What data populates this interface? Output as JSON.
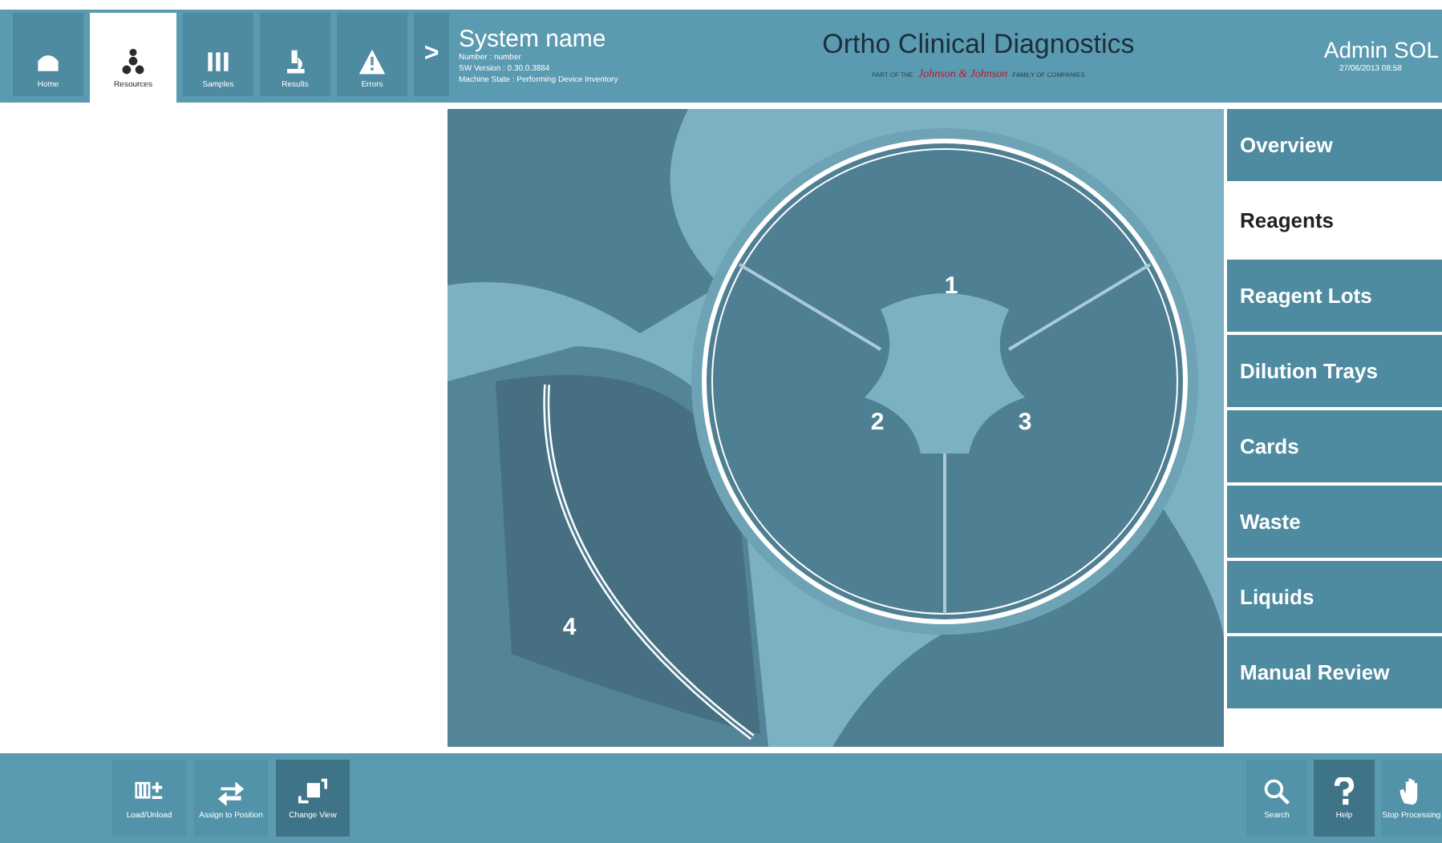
{
  "nav_tabs": [
    {
      "label": "Home",
      "kind": "home",
      "selected": false
    },
    {
      "label": "Resources",
      "kind": "resources",
      "selected": true
    },
    {
      "label": "Samples",
      "kind": "samples",
      "selected": false
    },
    {
      "label": "Results",
      "kind": "results",
      "selected": false
    },
    {
      "label": "Errors",
      "kind": "errors",
      "selected": false
    }
  ],
  "nav_more": ">",
  "system": {
    "name": "System name",
    "lines": [
      "Number : number",
      "SW Version : 0.30.0.3884",
      "Machine State : Performing Device Inventory"
    ]
  },
  "logo": {
    "title": "Ortho Clinical Diagnostics",
    "left": "PART OF THE",
    "brand": "Johnson & Johnson",
    "right": "FAMILY OF COMPANIES"
  },
  "user": {
    "name": "Admin SOL",
    "datetime": "27/06/2013 08:58"
  },
  "carousel": {
    "segments": [
      "1",
      "2",
      "3"
    ],
    "tray": "4"
  },
  "side_menu": [
    {
      "label": "Overview",
      "selected": false
    },
    {
      "label": "Reagents",
      "selected": true
    },
    {
      "label": "Reagent Lots",
      "selected": false
    },
    {
      "label": "Dilution Trays",
      "selected": false
    },
    {
      "label": "Cards",
      "selected": false
    },
    {
      "label": "Waste",
      "selected": false
    },
    {
      "label": "Liquids",
      "selected": false
    },
    {
      "label": "Manual Review",
      "selected": false
    }
  ],
  "bottom_left": [
    {
      "label": "Load/Unload",
      "kind": "load",
      "selected": false
    },
    {
      "label": "Assign to Position",
      "kind": "assign",
      "selected": false
    },
    {
      "label": "Change View",
      "kind": "view",
      "selected": true
    }
  ],
  "bottom_right": [
    {
      "label": "Search",
      "kind": "search",
      "selected": false
    },
    {
      "label": "Help",
      "kind": "help",
      "selected": true
    },
    {
      "label": "Stop Processing",
      "kind": "stop",
      "selected": false
    }
  ]
}
